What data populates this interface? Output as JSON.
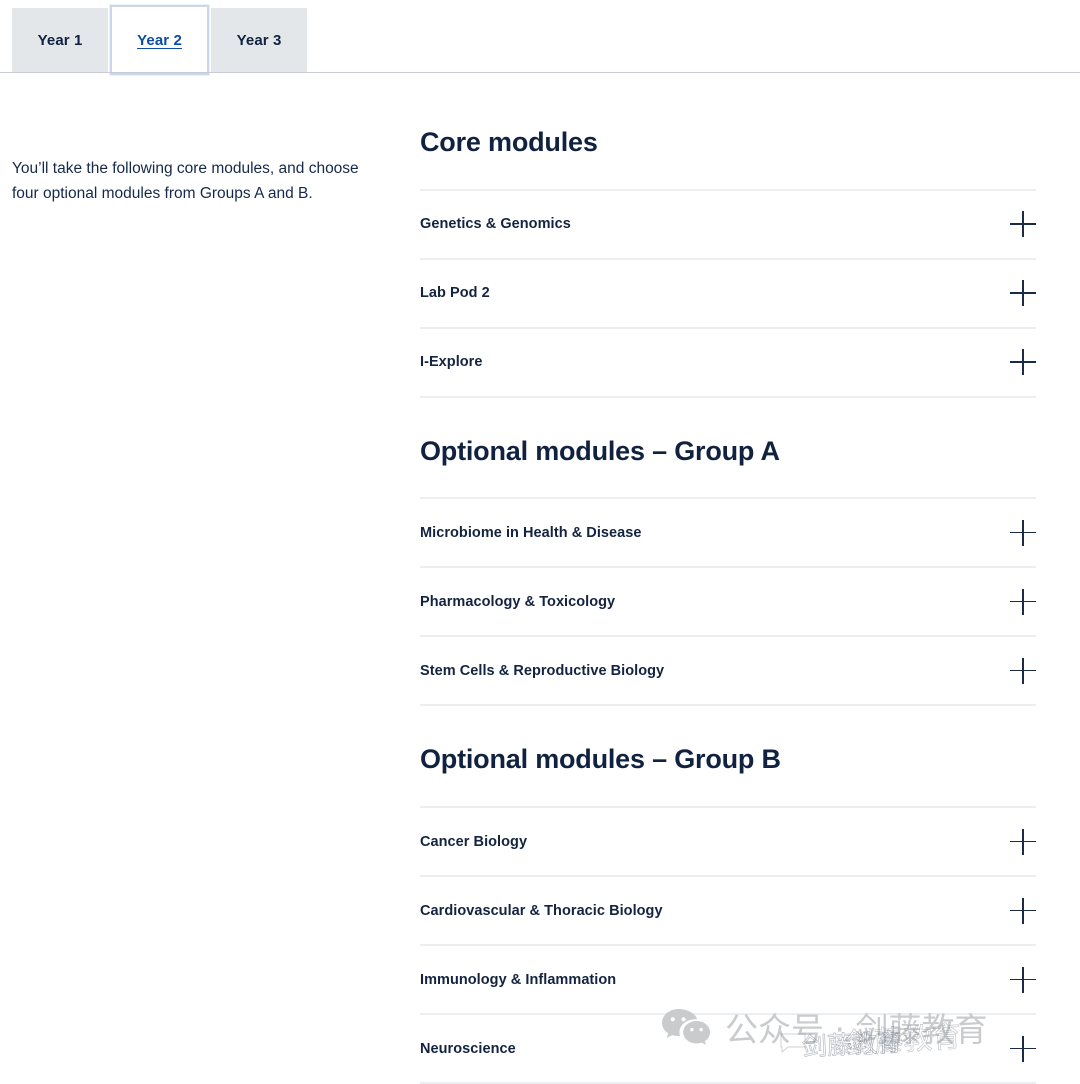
{
  "tabs": {
    "items": [
      {
        "label": "Year 1",
        "active": false
      },
      {
        "label": "Year 2",
        "active": true
      },
      {
        "label": "Year 3",
        "active": false
      }
    ]
  },
  "intro": {
    "text": "You’ll take the following core modules, and choose four optional modules from Groups A and B."
  },
  "sections": [
    {
      "title": "Core modules",
      "items": [
        {
          "label": "Genetics & Genomics",
          "toggle": "plus-icon"
        },
        {
          "label": "Lab Pod 2",
          "toggle": "plus-icon"
        },
        {
          "label": "I-Explore",
          "toggle": "plus-icon"
        }
      ]
    },
    {
      "title": "Optional modules – Group A",
      "items": [
        {
          "label": "Microbiome in Health & Disease",
          "toggle": "plus-icon"
        },
        {
          "label": "Pharmacology & Toxicology",
          "toggle": "plus-icon"
        },
        {
          "label": "Stem Cells & Reproductive Biology",
          "toggle": "plus-icon"
        }
      ]
    },
    {
      "title": "Optional modules – Group B",
      "items": [
        {
          "label": "Cancer Biology",
          "toggle": "plus-icon"
        },
        {
          "label": "Cardiovascular & Thoracic Biology",
          "toggle": "plus-icon"
        },
        {
          "label": "Immunology & Inflammation",
          "toggle": "plus-icon"
        },
        {
          "label": "Neuroscience",
          "toggle": "plus-icon"
        }
      ]
    }
  ],
  "watermark": {
    "text": "公众号 · 剑藤教育",
    "ghost_text": "剑藤教育",
    "ghost_text_2": "剑藤教育",
    "logo": "wechat-icon",
    "color": "#c9cbcd"
  },
  "colors": {
    "heading": "#10223f",
    "link": "#0b4da2",
    "tab_inactive_bg": "#e3e7ea",
    "divider": "#eceff1",
    "rule": "#c9ccd4"
  }
}
